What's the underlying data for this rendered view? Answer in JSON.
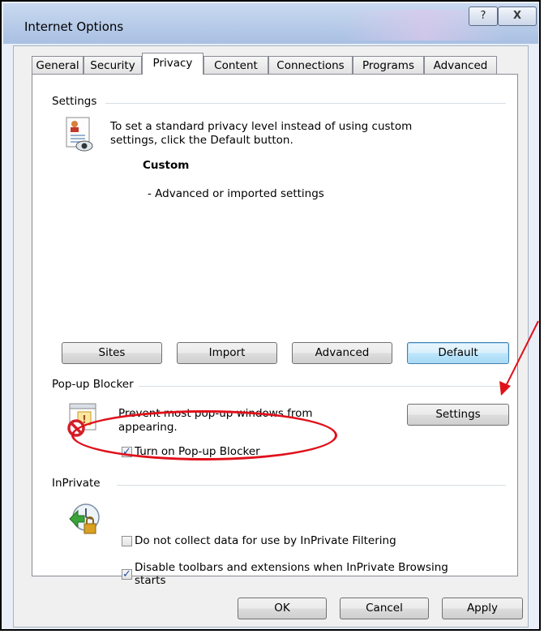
{
  "window": {
    "title": "Internet Options",
    "help_label": "?",
    "close_label": "X"
  },
  "tabs": [
    {
      "label": "General"
    },
    {
      "label": "Security"
    },
    {
      "label": "Privacy"
    },
    {
      "label": "Content"
    },
    {
      "label": "Connections"
    },
    {
      "label": "Programs"
    },
    {
      "label": "Advanced"
    }
  ],
  "settings": {
    "group_label": "Settings",
    "description_line1": "To set a standard privacy level instead of using custom",
    "description_line2": "settings, click the Default button.",
    "level_name": "Custom",
    "level_detail": "- Advanced or imported settings",
    "buttons": {
      "sites": "Sites",
      "import": "Import",
      "advanced": "Advanced",
      "default": "Default"
    }
  },
  "popup_blocker": {
    "group_label": "Pop-up Blocker",
    "description_line1": "Prevent most pop-up windows from",
    "description_line2": "appearing.",
    "settings_button": "Settings",
    "checkbox_label": "Turn on Pop-up Blocker",
    "checkbox_checked": true
  },
  "inprivate": {
    "group_label": "InPrivate",
    "option1_label": "Do not collect data for use by InPrivate Filtering",
    "option1_checked": false,
    "option2_line1": "Disable toolbars and extensions when InPrivate Browsing",
    "option2_line2": "starts",
    "option2_checked": true
  },
  "footer": {
    "ok": "OK",
    "cancel": "Cancel",
    "apply": "Apply"
  },
  "annotation_color": "#e0101a"
}
